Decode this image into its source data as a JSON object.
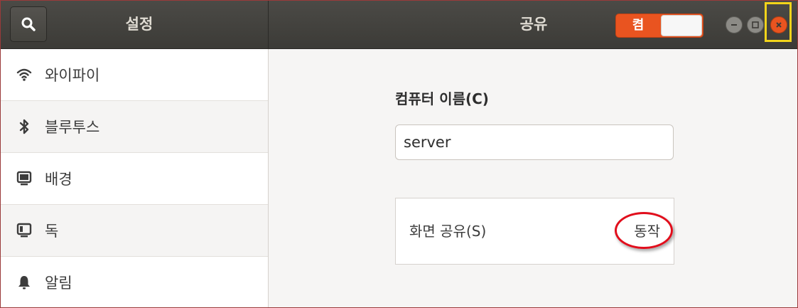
{
  "header": {
    "sidebar_title": "설정",
    "panel_title": "공유",
    "master_toggle": {
      "label": "켬",
      "state": "on"
    },
    "window_buttons": [
      "minimize",
      "maximize",
      "close"
    ]
  },
  "sidebar": {
    "items": [
      {
        "label": "와이파이",
        "icon": "wifi-icon"
      },
      {
        "label": "블루투스",
        "icon": "bluetooth-icon"
      },
      {
        "label": "배경",
        "icon": "monitor-icon"
      },
      {
        "label": "독",
        "icon": "dock-icon"
      },
      {
        "label": "알림",
        "icon": "bell-icon"
      }
    ]
  },
  "main": {
    "computer_name_label": "컴퓨터 이름(C)",
    "computer_name_value": "server",
    "screen_sharing": {
      "label": "화면 공유(S)",
      "status": "동작"
    }
  },
  "colors": {
    "accent": "#e95420",
    "header": "#3c3b37",
    "highlight_box": "#f2d41a",
    "annotation_circle": "#e10e1c"
  }
}
